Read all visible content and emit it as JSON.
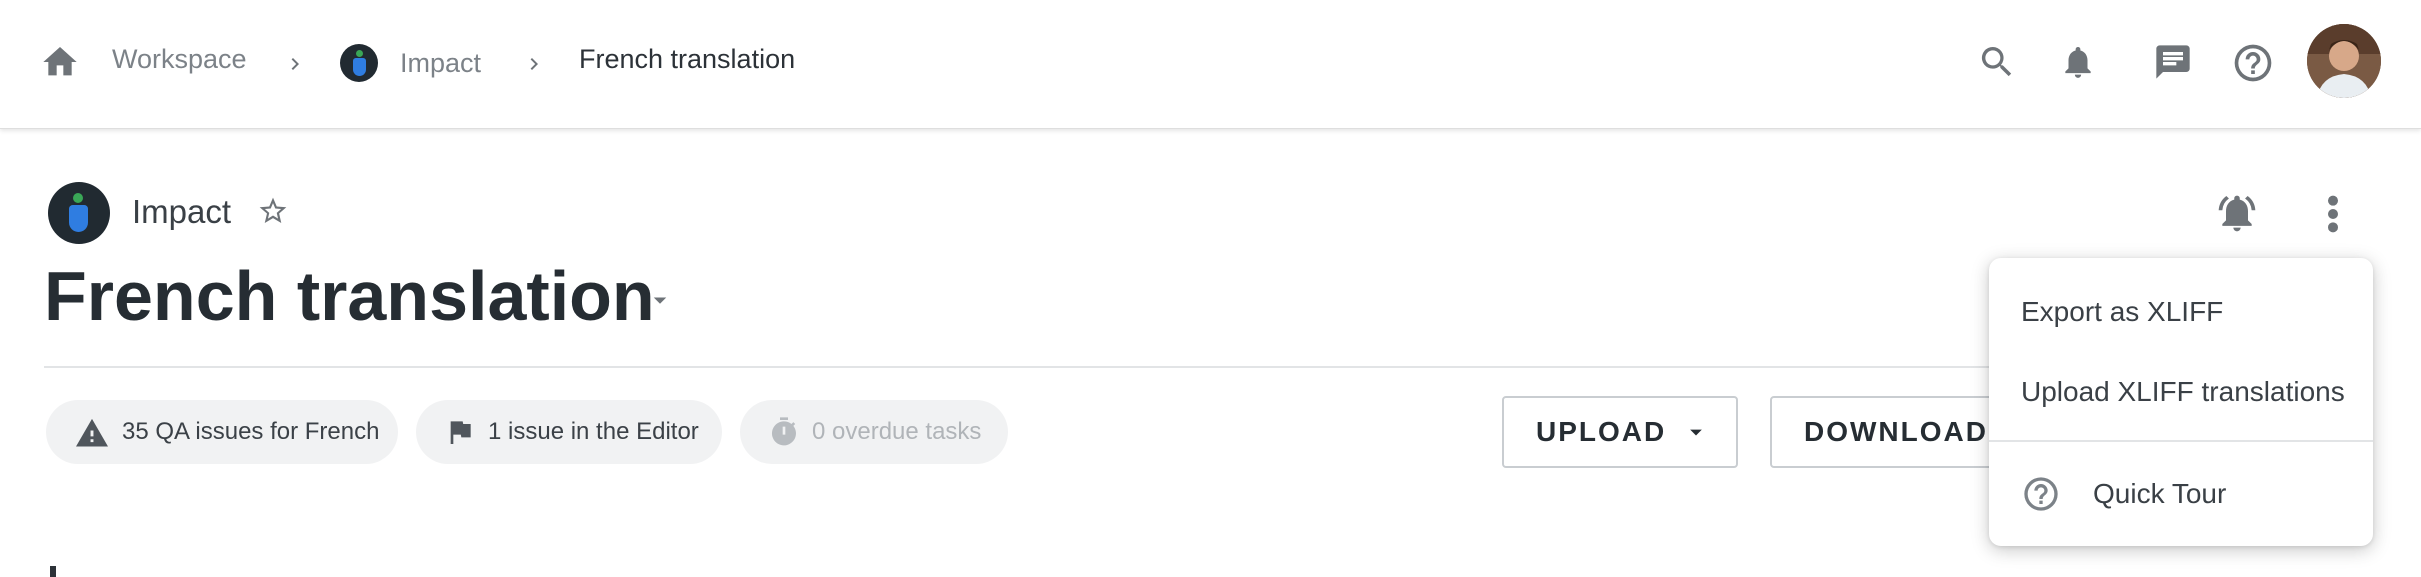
{
  "breadcrumb": {
    "home_icon": "home-icon",
    "items": [
      {
        "label": "Workspace"
      },
      {
        "label": "Impact"
      },
      {
        "label": "French translation"
      }
    ],
    "separator_icon": "chevron-right-icon"
  },
  "header_actions": {
    "icons": [
      "search-icon",
      "bell-icon",
      "chat-icon",
      "help-icon"
    ],
    "avatar": "user-avatar"
  },
  "project": {
    "name": "Impact",
    "favorite_icon": "star-outline-icon"
  },
  "page": {
    "title": "French translation",
    "title_dropdown_icon": "caret-down-icon"
  },
  "chips": [
    {
      "icon": "warning-icon",
      "label": "35 QA issues for French",
      "enabled": true
    },
    {
      "icon": "flag-icon",
      "label": "1 issue in the Editor",
      "enabled": true
    },
    {
      "icon": "stopwatch-icon",
      "label": "0 overdue tasks",
      "enabled": false
    }
  ],
  "toolbar": {
    "upload_label": "UPLOAD",
    "download_label": "DOWNLOAD",
    "notification_icon": "bell-ringing-icon",
    "more_icon": "more-vertical-icon"
  },
  "menu": {
    "items": [
      {
        "label": "Export as XLIFF"
      },
      {
        "label": "Upload XLIFF translations"
      }
    ],
    "footer": {
      "icon": "help-circle-icon",
      "label": "Quick Tour"
    }
  },
  "colors": {
    "text_primary": "#262d33",
    "text_muted": "#7c8288",
    "icon_gray": "#6e7378",
    "chip_bg": "#f1f2f3",
    "logo_dark": "#212a31",
    "logo_blue": "#2f7de1",
    "logo_green": "#3aa757"
  }
}
